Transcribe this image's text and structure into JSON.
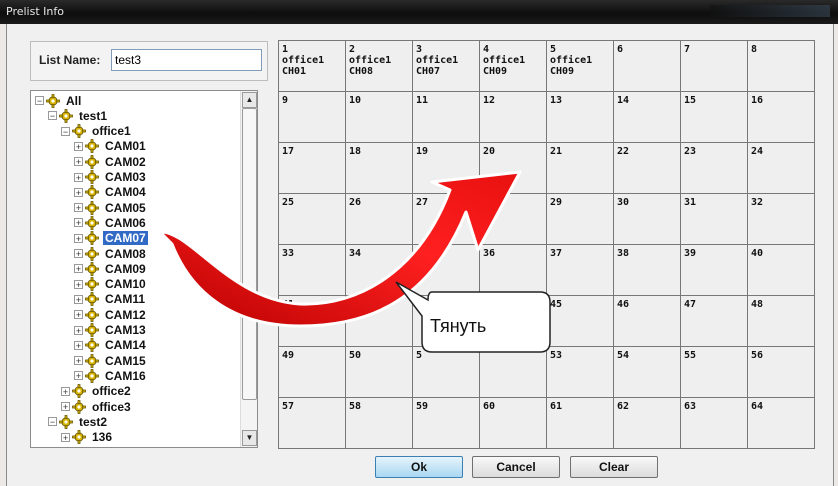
{
  "window": {
    "title": "Prelist Info"
  },
  "list_name": {
    "label": "List Name:",
    "value": "test3"
  },
  "tree": [
    {
      "label": "All",
      "level": 0,
      "toggle": "−"
    },
    {
      "label": "test1",
      "level": 1,
      "toggle": "−"
    },
    {
      "label": "office1",
      "level": 2,
      "toggle": "−"
    },
    {
      "label": "CAM01",
      "level": 3,
      "toggle": "+"
    },
    {
      "label": "CAM02",
      "level": 3,
      "toggle": "+"
    },
    {
      "label": "CAM03",
      "level": 3,
      "toggle": "+"
    },
    {
      "label": "CAM04",
      "level": 3,
      "toggle": "+"
    },
    {
      "label": "CAM05",
      "level": 3,
      "toggle": "+"
    },
    {
      "label": "CAM06",
      "level": 3,
      "toggle": "+"
    },
    {
      "label": "CAM07",
      "level": 3,
      "toggle": "+",
      "selected": true
    },
    {
      "label": "CAM08",
      "level": 3,
      "toggle": "+"
    },
    {
      "label": "CAM09",
      "level": 3,
      "toggle": "+"
    },
    {
      "label": "CAM10",
      "level": 3,
      "toggle": "+"
    },
    {
      "label": "CAM11",
      "level": 3,
      "toggle": "+"
    },
    {
      "label": "CAM12",
      "level": 3,
      "toggle": "+"
    },
    {
      "label": "CAM13",
      "level": 3,
      "toggle": "+"
    },
    {
      "label": "CAM14",
      "level": 3,
      "toggle": "+"
    },
    {
      "label": "CAM15",
      "level": 3,
      "toggle": "+"
    },
    {
      "label": "CAM16",
      "level": 3,
      "toggle": "+"
    },
    {
      "label": "office2",
      "level": 2,
      "toggle": "+"
    },
    {
      "label": "office3",
      "level": 2,
      "toggle": "+"
    },
    {
      "label": "test2",
      "level": 1,
      "toggle": "−"
    },
    {
      "label": "136",
      "level": 2,
      "toggle": "+"
    }
  ],
  "grid": [
    {
      "num": "1",
      "lines": [
        "office1",
        "CH01"
      ]
    },
    {
      "num": "2",
      "lines": [
        "office1",
        "CH08"
      ]
    },
    {
      "num": "3",
      "lines": [
        "office1",
        "CH07"
      ]
    },
    {
      "num": "4",
      "lines": [
        "office1",
        "CH09"
      ]
    },
    {
      "num": "5",
      "lines": [
        "office1",
        "CH09"
      ]
    },
    {
      "num": "6"
    },
    {
      "num": "7"
    },
    {
      "num": "8"
    },
    {
      "num": "9"
    },
    {
      "num": "10"
    },
    {
      "num": "11"
    },
    {
      "num": "12"
    },
    {
      "num": "13"
    },
    {
      "num": "14"
    },
    {
      "num": "15"
    },
    {
      "num": "16"
    },
    {
      "num": "17"
    },
    {
      "num": "18"
    },
    {
      "num": "19"
    },
    {
      "num": "20"
    },
    {
      "num": "21"
    },
    {
      "num": "22"
    },
    {
      "num": "23"
    },
    {
      "num": "24"
    },
    {
      "num": "25"
    },
    {
      "num": "26"
    },
    {
      "num": "27"
    },
    {
      "num": "28"
    },
    {
      "num": "29"
    },
    {
      "num": "30"
    },
    {
      "num": "31"
    },
    {
      "num": "32"
    },
    {
      "num": "33"
    },
    {
      "num": "34"
    },
    {
      "num": ""
    },
    {
      "num": "36"
    },
    {
      "num": "37"
    },
    {
      "num": "38"
    },
    {
      "num": "39"
    },
    {
      "num": "40"
    },
    {
      "num": "41"
    },
    {
      "num": "42"
    },
    {
      "num": ""
    },
    {
      "num": ""
    },
    {
      "num": "45"
    },
    {
      "num": "46"
    },
    {
      "num": "47"
    },
    {
      "num": "48"
    },
    {
      "num": "49"
    },
    {
      "num": "50"
    },
    {
      "num": "5"
    },
    {
      "num": ""
    },
    {
      "num": "53"
    },
    {
      "num": "54"
    },
    {
      "num": "55"
    },
    {
      "num": "56"
    },
    {
      "num": "57"
    },
    {
      "num": "58"
    },
    {
      "num": "59"
    },
    {
      "num": "60"
    },
    {
      "num": "61"
    },
    {
      "num": "62"
    },
    {
      "num": "63"
    },
    {
      "num": "64"
    }
  ],
  "buttons": {
    "ok": "Ok",
    "cancel": "Cancel",
    "clear": "Clear"
  },
  "annotation": {
    "text": "Тянуть",
    "arrow_color": "#e01010"
  }
}
